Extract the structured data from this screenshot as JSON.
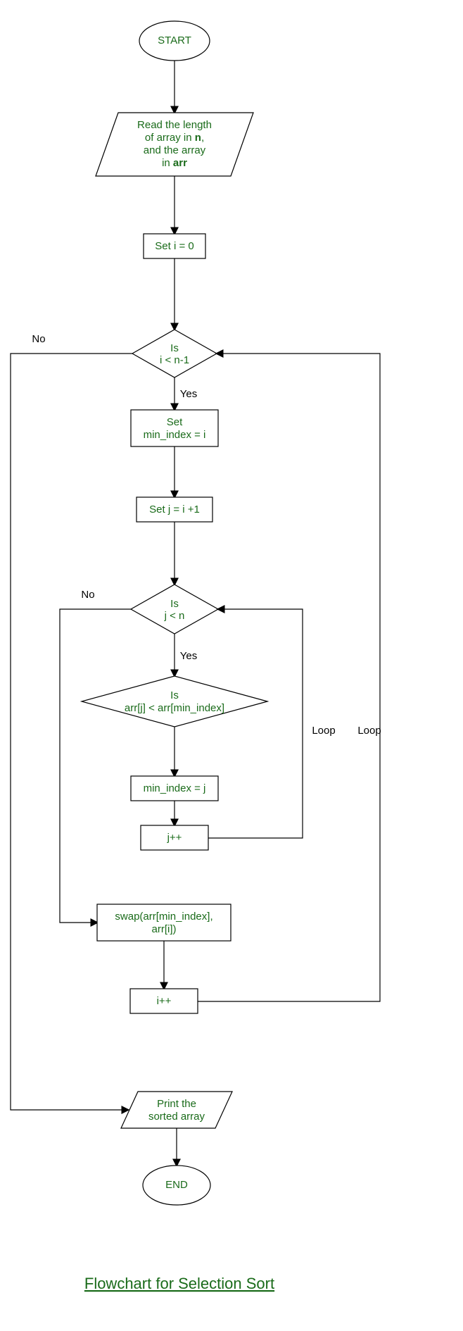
{
  "nodes": {
    "start": "START",
    "read_line1": "Read the length",
    "read_line2_a": "of array in ",
    "read_line2_b": "n",
    "read_line2_c": ",",
    "read_line3": "and the array",
    "read_line4_a": "in ",
    "read_line4_b": "arr",
    "set_i": "Set i = 0",
    "dec_i_l1": "Is",
    "dec_i_l2": "i < n-1",
    "set_min_l1": "Set",
    "set_min_l2": "min_index = i",
    "set_j": "Set j = i +1",
    "dec_j_l1": "Is",
    "dec_j_l2": "j < n",
    "dec_arr_l1": "Is",
    "dec_arr_l2": "arr[j] < arr[min_index]",
    "min_assign": "min_index = j",
    "j_inc": "j++",
    "swap_l1": "swap(arr[min_index],",
    "swap_l2": "arr[i])",
    "i_inc": "i++",
    "print_l1": "Print the",
    "print_l2": "sorted array",
    "end": "END"
  },
  "labels": {
    "no": "No",
    "yes": "Yes",
    "loop": "Loop"
  },
  "caption": "Flowchart for Selection Sort"
}
